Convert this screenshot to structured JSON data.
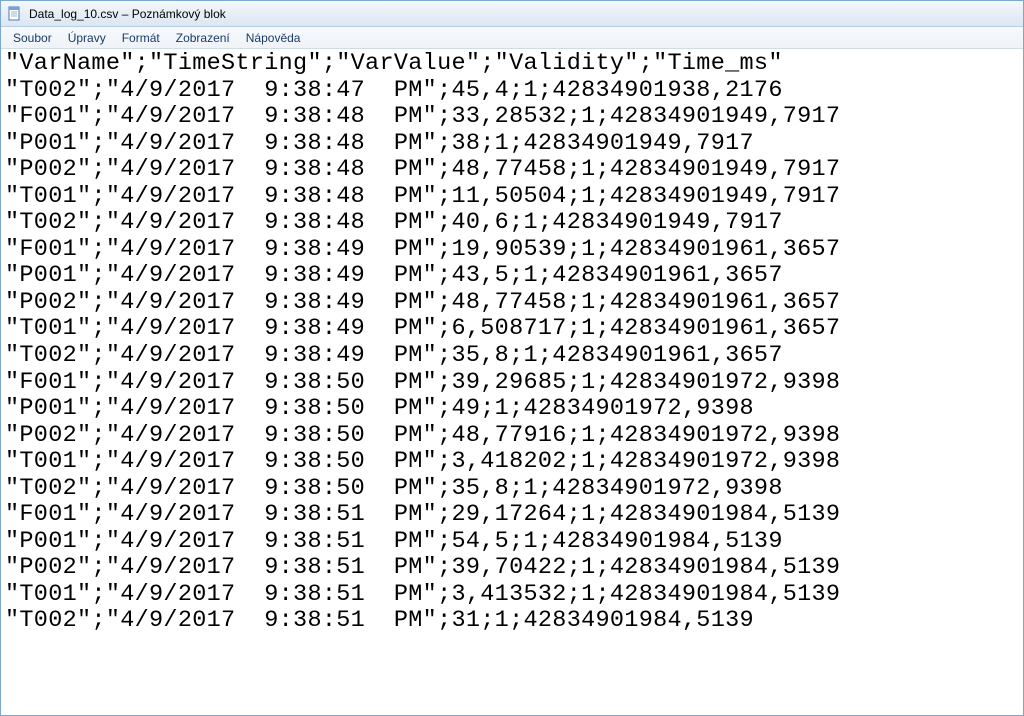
{
  "window": {
    "title": "Data_log_10.csv – Poznámkový blok"
  },
  "menu": {
    "soubor": "Soubor",
    "upravy": "Úpravy",
    "format": "Formát",
    "zobrazeni": "Zobrazení",
    "napoveda": "Nápověda"
  },
  "csv": {
    "header": [
      "VarName",
      "TimeString",
      "VarValue",
      "Validity",
      "Time_ms"
    ],
    "rows": [
      {
        "var": "T002",
        "time": "4/9/2017 9:38:47 PM",
        "val": "45,4",
        "valid": "1",
        "ms": "42834901938,2176"
      },
      {
        "var": "F001",
        "time": "4/9/2017 9:38:48 PM",
        "val": "33,28532",
        "valid": "1",
        "ms": "42834901949,7917"
      },
      {
        "var": "P001",
        "time": "4/9/2017 9:38:48 PM",
        "val": "38",
        "valid": "1",
        "ms": "42834901949,7917"
      },
      {
        "var": "P002",
        "time": "4/9/2017 9:38:48 PM",
        "val": "48,77458",
        "valid": "1",
        "ms": "42834901949,7917"
      },
      {
        "var": "T001",
        "time": "4/9/2017 9:38:48 PM",
        "val": "11,50504",
        "valid": "1",
        "ms": "42834901949,7917"
      },
      {
        "var": "T002",
        "time": "4/9/2017 9:38:48 PM",
        "val": "40,6",
        "valid": "1",
        "ms": "42834901949,7917"
      },
      {
        "var": "F001",
        "time": "4/9/2017 9:38:49 PM",
        "val": "19,90539",
        "valid": "1",
        "ms": "42834901961,3657"
      },
      {
        "var": "P001",
        "time": "4/9/2017 9:38:49 PM",
        "val": "43,5",
        "valid": "1",
        "ms": "42834901961,3657"
      },
      {
        "var": "P002",
        "time": "4/9/2017 9:38:49 PM",
        "val": "48,77458",
        "valid": "1",
        "ms": "42834901961,3657"
      },
      {
        "var": "T001",
        "time": "4/9/2017 9:38:49 PM",
        "val": "6,508717",
        "valid": "1",
        "ms": "42834901961,3657"
      },
      {
        "var": "T002",
        "time": "4/9/2017 9:38:49 PM",
        "val": "35,8",
        "valid": "1",
        "ms": "42834901961,3657"
      },
      {
        "var": "F001",
        "time": "4/9/2017 9:38:50 PM",
        "val": "39,29685",
        "valid": "1",
        "ms": "42834901972,9398"
      },
      {
        "var": "P001",
        "time": "4/9/2017 9:38:50 PM",
        "val": "49",
        "valid": "1",
        "ms": "42834901972,9398"
      },
      {
        "var": "P002",
        "time": "4/9/2017 9:38:50 PM",
        "val": "48,77916",
        "valid": "1",
        "ms": "42834901972,9398"
      },
      {
        "var": "T001",
        "time": "4/9/2017 9:38:50 PM",
        "val": "3,418202",
        "valid": "1",
        "ms": "42834901972,9398"
      },
      {
        "var": "T002",
        "time": "4/9/2017 9:38:50 PM",
        "val": "35,8",
        "valid": "1",
        "ms": "42834901972,9398"
      },
      {
        "var": "F001",
        "time": "4/9/2017 9:38:51 PM",
        "val": "29,17264",
        "valid": "1",
        "ms": "42834901984,5139"
      },
      {
        "var": "P001",
        "time": "4/9/2017 9:38:51 PM",
        "val": "54,5",
        "valid": "1",
        "ms": "42834901984,5139"
      },
      {
        "var": "P002",
        "time": "4/9/2017 9:38:51 PM",
        "val": "39,70422",
        "valid": "1",
        "ms": "42834901984,5139"
      },
      {
        "var": "T001",
        "time": "4/9/2017 9:38:51 PM",
        "val": "3,413532",
        "valid": "1",
        "ms": "42834901984,5139"
      },
      {
        "var": "T002",
        "time": "4/9/2017 9:38:51 PM",
        "val": "31",
        "valid": "1",
        "ms": "42834901984,5139"
      }
    ]
  }
}
